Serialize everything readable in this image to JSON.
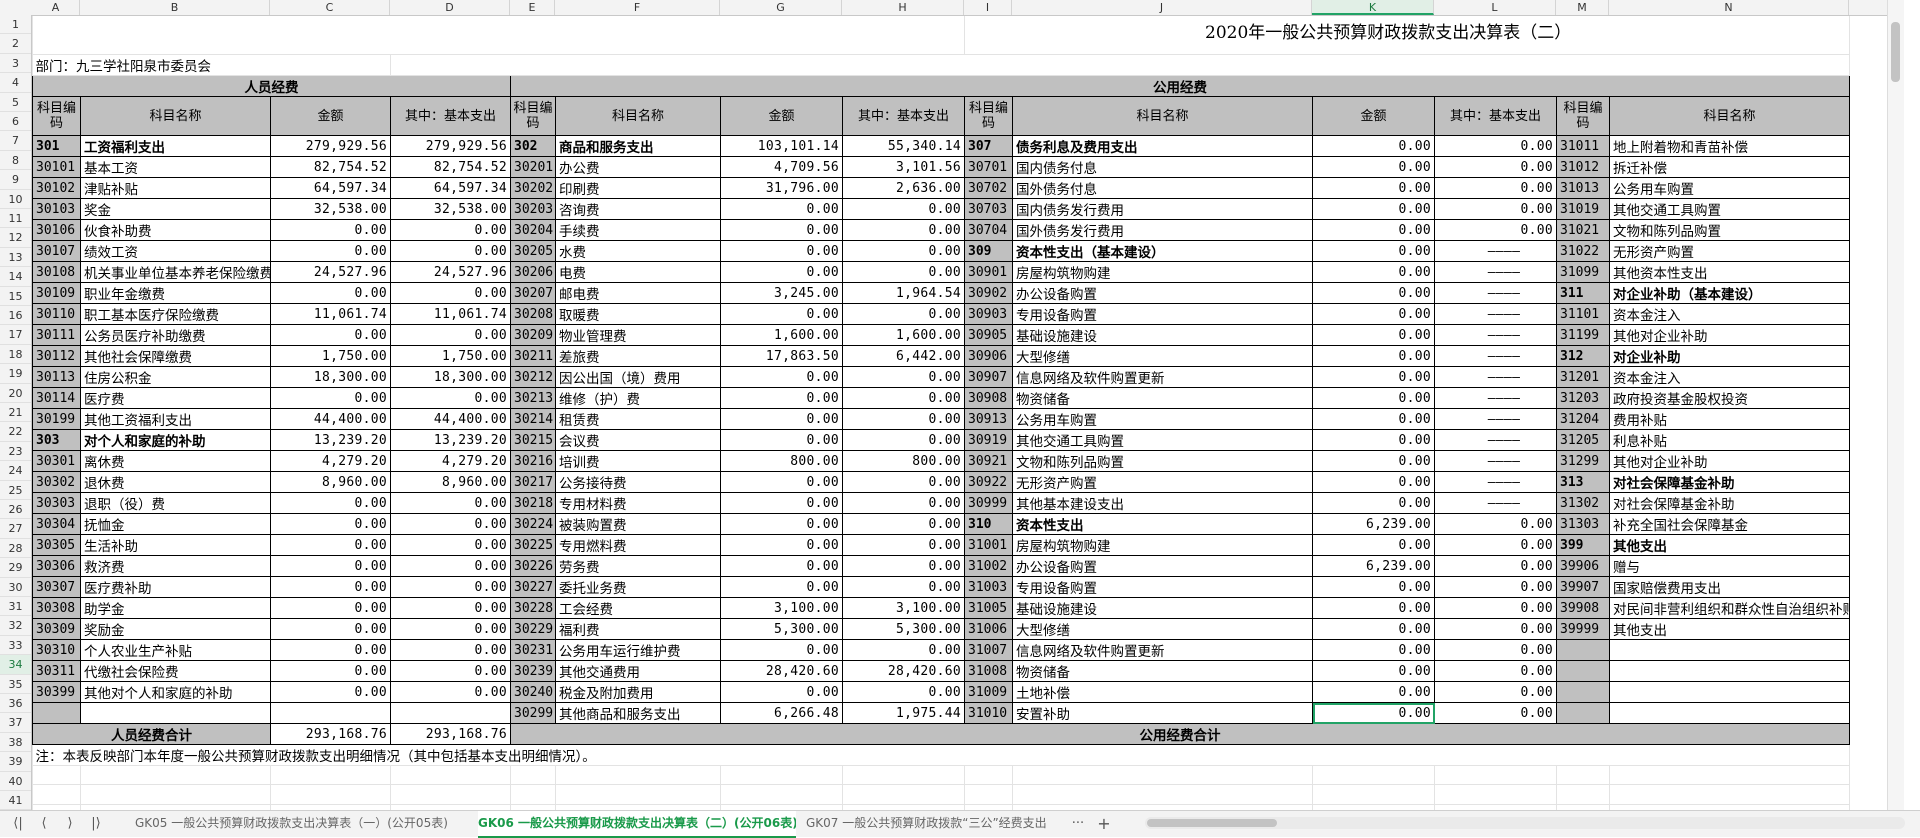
{
  "columns": [
    "A",
    "B",
    "C",
    "D",
    "E",
    "F",
    "G",
    "H",
    "I",
    "J",
    "K",
    "L",
    "M",
    "N"
  ],
  "selected_column": "K",
  "selected_row": "34",
  "rows": [
    "1",
    "2",
    "3",
    "4",
    "5",
    "6",
    "7",
    "8",
    "9",
    "10",
    "11",
    "12",
    "13",
    "14",
    "15",
    "16",
    "17",
    "18",
    "19",
    "20",
    "21",
    "22",
    "23",
    "24",
    "25",
    "26",
    "27",
    "28",
    "29",
    "30",
    "31",
    "32",
    "33",
    "34",
    "35",
    "36",
    "37",
    "38",
    "39",
    "40",
    "41"
  ],
  "title": "2020年一般公共预算财政拨款支出决算表（二）",
  "department": "部门：九三学社阳泉市委员会",
  "section_personnel": "人员经费",
  "section_public": "公用经费",
  "headers": {
    "code": "科目编码",
    "name": "科目名称",
    "amount": "金额",
    "basic": "其中：基本支出"
  },
  "personnel": [
    {
      "code": "301",
      "name": "工资福利支出",
      "amount": "279,929.56",
      "basic": "279,929.56",
      "bold": true
    },
    {
      "code": "30101",
      "name": "基本工资",
      "amount": "82,754.52",
      "basic": "82,754.52"
    },
    {
      "code": "30102",
      "name": "津贴补贴",
      "amount": "64,597.34",
      "basic": "64,597.34"
    },
    {
      "code": "30103",
      "name": "奖金",
      "amount": "32,538.00",
      "basic": "32,538.00"
    },
    {
      "code": "30106",
      "name": "伙食补助费",
      "amount": "0.00",
      "basic": "0.00"
    },
    {
      "code": "30107",
      "name": "绩效工资",
      "amount": "0.00",
      "basic": "0.00"
    },
    {
      "code": "30108",
      "name": "机关事业单位基本养老保险缴费",
      "amount": "24,527.96",
      "basic": "24,527.96"
    },
    {
      "code": "30109",
      "name": "职业年金缴费",
      "amount": "0.00",
      "basic": "0.00"
    },
    {
      "code": "30110",
      "name": "职工基本医疗保险缴费",
      "amount": "11,061.74",
      "basic": "11,061.74"
    },
    {
      "code": "30111",
      "name": "公务员医疗补助缴费",
      "amount": "0.00",
      "basic": "0.00"
    },
    {
      "code": "30112",
      "name": "其他社会保障缴费",
      "amount": "1,750.00",
      "basic": "1,750.00"
    },
    {
      "code": "30113",
      "name": "住房公积金",
      "amount": "18,300.00",
      "basic": "18,300.00"
    },
    {
      "code": "30114",
      "name": "医疗费",
      "amount": "0.00",
      "basic": "0.00"
    },
    {
      "code": "30199",
      "name": "其他工资福利支出",
      "amount": "44,400.00",
      "basic": "44,400.00"
    },
    {
      "code": "303",
      "name": "对个人和家庭的补助",
      "amount": "13,239.20",
      "basic": "13,239.20",
      "bold": true
    },
    {
      "code": "30301",
      "name": "离休费",
      "amount": "4,279.20",
      "basic": "4,279.20"
    },
    {
      "code": "30302",
      "name": "退休费",
      "amount": "8,960.00",
      "basic": "8,960.00"
    },
    {
      "code": "30303",
      "name": "退职（役）费",
      "amount": "0.00",
      "basic": "0.00"
    },
    {
      "code": "30304",
      "name": "抚恤金",
      "amount": "0.00",
      "basic": "0.00"
    },
    {
      "code": "30305",
      "name": "生活补助",
      "amount": "0.00",
      "basic": "0.00"
    },
    {
      "code": "30306",
      "name": "救济费",
      "amount": "0.00",
      "basic": "0.00"
    },
    {
      "code": "30307",
      "name": "医疗费补助",
      "amount": "0.00",
      "basic": "0.00"
    },
    {
      "code": "30308",
      "name": "助学金",
      "amount": "0.00",
      "basic": "0.00"
    },
    {
      "code": "30309",
      "name": "奖励金",
      "amount": "0.00",
      "basic": "0.00"
    },
    {
      "code": "30310",
      "name": "个人农业生产补贴",
      "amount": "0.00",
      "basic": "0.00"
    },
    {
      "code": "30311",
      "name": "代缴社会保险费",
      "amount": "0.00",
      "basic": "0.00"
    },
    {
      "code": "30399",
      "name": "其他对个人和家庭的补助",
      "amount": "0.00",
      "basic": "0.00"
    },
    {
      "code": "",
      "name": "",
      "amount": "",
      "basic": ""
    }
  ],
  "goods": [
    {
      "code": "302",
      "name": "商品和服务支出",
      "amount": "103,101.14",
      "basic": "55,340.14",
      "bold": true
    },
    {
      "code": "30201",
      "name": "办公费",
      "amount": "4,709.56",
      "basic": "3,101.56"
    },
    {
      "code": "30202",
      "name": "印刷费",
      "amount": "31,796.00",
      "basic": "2,636.00"
    },
    {
      "code": "30203",
      "name": "咨询费",
      "amount": "0.00",
      "basic": "0.00"
    },
    {
      "code": "30204",
      "name": "手续费",
      "amount": "0.00",
      "basic": "0.00"
    },
    {
      "code": "30205",
      "name": "水费",
      "amount": "0.00",
      "basic": "0.00"
    },
    {
      "code": "30206",
      "name": "电费",
      "amount": "0.00",
      "basic": "0.00"
    },
    {
      "code": "30207",
      "name": "邮电费",
      "amount": "3,245.00",
      "basic": "1,964.54"
    },
    {
      "code": "30208",
      "name": "取暖费",
      "amount": "0.00",
      "basic": "0.00"
    },
    {
      "code": "30209",
      "name": "物业管理费",
      "amount": "1,600.00",
      "basic": "1,600.00"
    },
    {
      "code": "30211",
      "name": "差旅费",
      "amount": "17,863.50",
      "basic": "6,442.00"
    },
    {
      "code": "30212",
      "name": "因公出国（境）费用",
      "amount": "0.00",
      "basic": "0.00"
    },
    {
      "code": "30213",
      "name": "维修（护）费",
      "amount": "0.00",
      "basic": "0.00"
    },
    {
      "code": "30214",
      "name": "租赁费",
      "amount": "0.00",
      "basic": "0.00"
    },
    {
      "code": "30215",
      "name": "会议费",
      "amount": "0.00",
      "basic": "0.00"
    },
    {
      "code": "30216",
      "name": "培训费",
      "amount": "800.00",
      "basic": "800.00"
    },
    {
      "code": "30217",
      "name": "公务接待费",
      "amount": "0.00",
      "basic": "0.00"
    },
    {
      "code": "30218",
      "name": "专用材料费",
      "amount": "0.00",
      "basic": "0.00"
    },
    {
      "code": "30224",
      "name": "被装购置费",
      "amount": "0.00",
      "basic": "0.00"
    },
    {
      "code": "30225",
      "name": "专用燃料费",
      "amount": "0.00",
      "basic": "0.00"
    },
    {
      "code": "30226",
      "name": "劳务费",
      "amount": "0.00",
      "basic": "0.00"
    },
    {
      "code": "30227",
      "name": "委托业务费",
      "amount": "0.00",
      "basic": "0.00"
    },
    {
      "code": "30228",
      "name": "工会经费",
      "amount": "3,100.00",
      "basic": "3,100.00"
    },
    {
      "code": "30229",
      "name": "福利费",
      "amount": "5,300.00",
      "basic": "5,300.00"
    },
    {
      "code": "30231",
      "name": "公务用车运行维护费",
      "amount": "0.00",
      "basic": "0.00"
    },
    {
      "code": "30239",
      "name": "其他交通费用",
      "amount": "28,420.60",
      "basic": "28,420.60"
    },
    {
      "code": "30240",
      "name": "税金及附加费用",
      "amount": "0.00",
      "basic": "0.00"
    },
    {
      "code": "30299",
      "name": "其他商品和服务支出",
      "amount": "6,266.48",
      "basic": "1,975.44"
    }
  ],
  "interest": [
    {
      "code": "307",
      "name": "债务利息及费用支出",
      "amount": "0.00",
      "basic": "0.00",
      "bold": true
    },
    {
      "code": "30701",
      "name": "国内债务付息",
      "amount": "0.00",
      "basic": "0.00"
    },
    {
      "code": "30702",
      "name": "国外债务付息",
      "amount": "0.00",
      "basic": "0.00"
    },
    {
      "code": "30703",
      "name": "国内债务发行费用",
      "amount": "0.00",
      "basic": "0.00"
    },
    {
      "code": "30704",
      "name": "国外债务发行费用",
      "amount": "0.00",
      "basic": "0.00"
    },
    {
      "code": "309",
      "name": "资本性支出（基本建设）",
      "amount": "0.00",
      "basic": "————",
      "bold": true
    },
    {
      "code": "30901",
      "name": "房屋构筑物购建",
      "amount": "0.00",
      "basic": "————"
    },
    {
      "code": "30902",
      "name": "办公设备购置",
      "amount": "0.00",
      "basic": "————"
    },
    {
      "code": "30903",
      "name": "专用设备购置",
      "amount": "0.00",
      "basic": "————"
    },
    {
      "code": "30905",
      "name": "基础设施建设",
      "amount": "0.00",
      "basic": "————"
    },
    {
      "code": "30906",
      "name": "大型修缮",
      "amount": "0.00",
      "basic": "————"
    },
    {
      "code": "30907",
      "name": "信息网络及软件购置更新",
      "amount": "0.00",
      "basic": "————"
    },
    {
      "code": "30908",
      "name": "物资储备",
      "amount": "0.00",
      "basic": "————"
    },
    {
      "code": "30913",
      "name": "公务用车购置",
      "amount": "0.00",
      "basic": "————"
    },
    {
      "code": "30919",
      "name": "其他交通工具购置",
      "amount": "0.00",
      "basic": "————"
    },
    {
      "code": "30921",
      "name": "文物和陈列品购置",
      "amount": "0.00",
      "basic": "————"
    },
    {
      "code": "30922",
      "name": "无形资产购置",
      "amount": "0.00",
      "basic": "————"
    },
    {
      "code": "30999",
      "name": "其他基本建设支出",
      "amount": "0.00",
      "basic": "————"
    },
    {
      "code": "310",
      "name": "资本性支出",
      "amount": "6,239.00",
      "basic": "0.00",
      "bold": true
    },
    {
      "code": "31001",
      "name": "房屋构筑物购建",
      "amount": "0.00",
      "basic": "0.00"
    },
    {
      "code": "31002",
      "name": "办公设备购置",
      "amount": "6,239.00",
      "basic": "0.00"
    },
    {
      "code": "31003",
      "name": "专用设备购置",
      "amount": "0.00",
      "basic": "0.00"
    },
    {
      "code": "31005",
      "name": "基础设施建设",
      "amount": "0.00",
      "basic": "0.00"
    },
    {
      "code": "31006",
      "name": "大型修缮",
      "amount": "0.00",
      "basic": "0.00"
    },
    {
      "code": "31007",
      "name": "信息网络及软件购置更新",
      "amount": "0.00",
      "basic": "0.00"
    },
    {
      "code": "31008",
      "name": "物资储备",
      "amount": "0.00",
      "basic": "0.00"
    },
    {
      "code": "31009",
      "name": "土地补偿",
      "amount": "0.00",
      "basic": "0.00"
    },
    {
      "code": "31010",
      "name": "安置补助",
      "amount": "0.00",
      "basic": "0.00"
    }
  ],
  "other": [
    {
      "code": "31011",
      "name": "地上附着物和青苗补偿"
    },
    {
      "code": "31012",
      "name": "拆迁补偿"
    },
    {
      "code": "31013",
      "name": "公务用车购置"
    },
    {
      "code": "31019",
      "name": "其他交通工具购置"
    },
    {
      "code": "31021",
      "name": "文物和陈列品购置"
    },
    {
      "code": "31022",
      "name": "无形资产购置"
    },
    {
      "code": "31099",
      "name": "其他资本性支出"
    },
    {
      "code": "311",
      "name": "对企业补助（基本建设）",
      "bold": true
    },
    {
      "code": "31101",
      "name": "资本金注入"
    },
    {
      "code": "31199",
      "name": "其他对企业补助"
    },
    {
      "code": "312",
      "name": "对企业补助",
      "bold": true
    },
    {
      "code": "31201",
      "name": "资本金注入"
    },
    {
      "code": "31203",
      "name": "政府投资基金股权投资"
    },
    {
      "code": "31204",
      "name": "费用补贴"
    },
    {
      "code": "31205",
      "name": "利息补贴"
    },
    {
      "code": "31299",
      "name": "其他对企业补助"
    },
    {
      "code": "313",
      "name": "对社会保障基金补助",
      "bold": true
    },
    {
      "code": "31302",
      "name": "对社会保障基金补助"
    },
    {
      "code": "31303",
      "name": "补充全国社会保障基金"
    },
    {
      "code": "399",
      "name": "其他支出",
      "bold": true
    },
    {
      "code": "39906",
      "name": "赠与"
    },
    {
      "code": "39907",
      "name": "国家赔偿费用支出"
    },
    {
      "code": "39908",
      "name": "对民间非营利组织和群众性自治组织补贴"
    },
    {
      "code": "39999",
      "name": "其他支出"
    },
    {
      "code": "",
      "name": ""
    },
    {
      "code": "",
      "name": ""
    },
    {
      "code": "",
      "name": ""
    },
    {
      "code": "",
      "name": ""
    }
  ],
  "totals": {
    "personnel_label": "人员经费合计",
    "personnel_amount": "293,168.76",
    "personnel_basic": "293,168.76",
    "public_label": "公用经费合计"
  },
  "note": "注：本表反映部门本年度一般公共预算财政拨款支出明细情况（其中包括基本支出明细情况）。",
  "tabs": [
    {
      "label": "GK05 一般公共预算财政拨款支出决算表（一）(公开05表)",
      "active": false
    },
    {
      "label": "GK06 一般公共预算财政拨款支出决算表（二）(公开06表)",
      "active": true
    },
    {
      "label": "GK07 一般公共预算财政拨款“三公”经费支出",
      "active": false
    }
  ],
  "nav": {
    "first": "⟨|",
    "prev": "⟨",
    "next": "⟩",
    "last": "|⟩",
    "more": "···",
    "add": "+"
  }
}
